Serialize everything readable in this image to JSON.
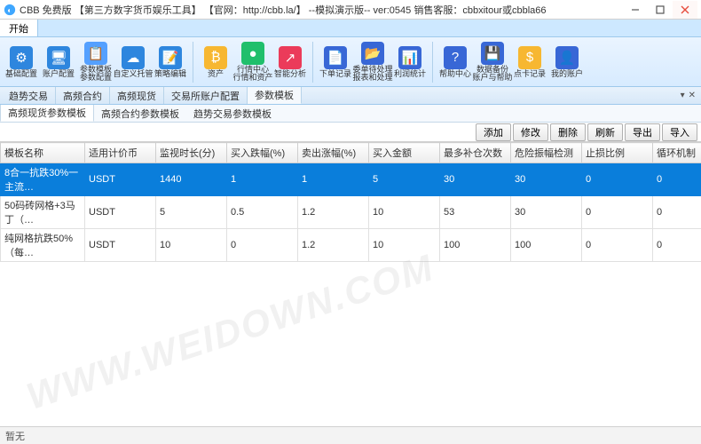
{
  "window": {
    "title": "CBB 免费版 【第三方数字货币娱乐工具】 【官网：http://cbb.la/】 --模拟演示版-- ver:0545    销售客服：cbbxitour或cbbla66"
  },
  "menubar": {
    "start": "开始"
  },
  "toolbar": {
    "items": [
      {
        "label": "基础配置",
        "color": "#2e86de",
        "glyph": "⚙"
      },
      {
        "label": "账户配置",
        "color": "#2e86de",
        "glyph": "🖥"
      },
      {
        "label": "参数模板\n参数配置",
        "color": "#54a0ff",
        "glyph": "📋"
      },
      {
        "label": "自定义托管",
        "color": "#2e86de",
        "glyph": "☁"
      },
      {
        "label": "策略编辑",
        "color": "#2e86de",
        "glyph": "📝"
      },
      {
        "label": "SEP"
      },
      {
        "label": "资产",
        "color": "#f7b731",
        "glyph": "₿"
      },
      {
        "label": "行情中心\n行情和资产",
        "color": "#20bf6b",
        "glyph": "●"
      },
      {
        "label": "智能分析",
        "color": "#eb3b5a",
        "glyph": "↗"
      },
      {
        "label": "SEP"
      },
      {
        "label": "下单记录",
        "color": "#3867d6",
        "glyph": "📄"
      },
      {
        "label": "委单待处理\n报表和处理",
        "color": "#3867d6",
        "glyph": "📂"
      },
      {
        "label": "利润统计",
        "color": "#3867d6",
        "glyph": "📊"
      },
      {
        "label": "SEP"
      },
      {
        "label": "帮助中心",
        "color": "#3867d6",
        "glyph": "?"
      },
      {
        "label": "数据备份\n账户与帮助",
        "color": "#3867d6",
        "glyph": "💾"
      },
      {
        "label": "点卡记录",
        "color": "#f7b731",
        "glyph": "$"
      },
      {
        "label": "我的账户",
        "color": "#3867d6",
        "glyph": "👤"
      }
    ]
  },
  "ribbon_tabs": {
    "items": [
      {
        "label": "趋势交易",
        "active": false
      },
      {
        "label": "高频合约",
        "active": false
      },
      {
        "label": "高频现货",
        "active": false
      },
      {
        "label": "交易所账户配置",
        "active": false
      },
      {
        "label": "参数模板",
        "active": true
      }
    ]
  },
  "sub_tabs": {
    "items": [
      {
        "label": "高频现货参数模板",
        "active": true
      },
      {
        "label": "高频合约参数模板",
        "active": false
      },
      {
        "label": "趋势交易参数模板",
        "active": false
      }
    ]
  },
  "actions": {
    "add": "添加",
    "edit": "修改",
    "delete": "删除",
    "refresh": "刷新",
    "export": "导出",
    "import": "导入"
  },
  "grid": {
    "columns": [
      "模板名称",
      "适用计价币",
      "监视时长(分)",
      "买入跌幅(%)",
      "卖出涨幅(%)",
      "买入金额",
      "最多补仓次数",
      "危险振幅检测",
      "止损比例",
      "循环机制"
    ],
    "widths": [
      95,
      80,
      80,
      80,
      80,
      80,
      80,
      80,
      80,
      70
    ],
    "rows": [
      {
        "selected": true,
        "cells": [
          "8合一抗跌30%一主流…",
          "USDT",
          "1440",
          "1",
          "1",
          "5",
          "30",
          "30",
          "0",
          "0"
        ]
      },
      {
        "selected": false,
        "cells": [
          "50码砖网格+3马丁（…",
          "USDT",
          "5",
          "0.5",
          "1.2",
          "10",
          "53",
          "30",
          "0",
          "0"
        ]
      },
      {
        "selected": false,
        "cells": [
          "纯网格抗跌50%（每…",
          "USDT",
          "10",
          "0",
          "1.2",
          "10",
          "100",
          "100",
          "0",
          "0"
        ]
      }
    ]
  },
  "status": {
    "text": "暂无"
  },
  "watermark": "WWW.WEIDOWN.COM"
}
